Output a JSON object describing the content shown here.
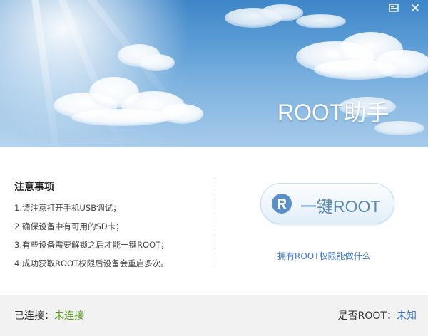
{
  "window": {
    "title": "ROOT助手",
    "controls": [
      {
        "name": "skin-icon"
      },
      {
        "name": "close-icon"
      }
    ]
  },
  "notes": {
    "title": "注意事项",
    "items": [
      "1.请注意打开手机USB调试；",
      "2.确保设备中有可用的SD卡；",
      "3.有些设备需要解锁之后才能一键ROOT；",
      "4.成功获取ROOT权限后设备会重启多次。"
    ]
  },
  "action": {
    "button_label": "一键ROOT",
    "button_icon": "r-logo-icon",
    "link_text": "拥有ROOT权限能做什么"
  },
  "status": {
    "connection_label": "已连接：",
    "connection_value": "未连接",
    "root_label": "是否ROOT：",
    "root_value": "未知"
  },
  "colors": {
    "accent_blue": "#3a78c6",
    "status_green": "#5aa11a",
    "button_text": "#5a88b4"
  }
}
